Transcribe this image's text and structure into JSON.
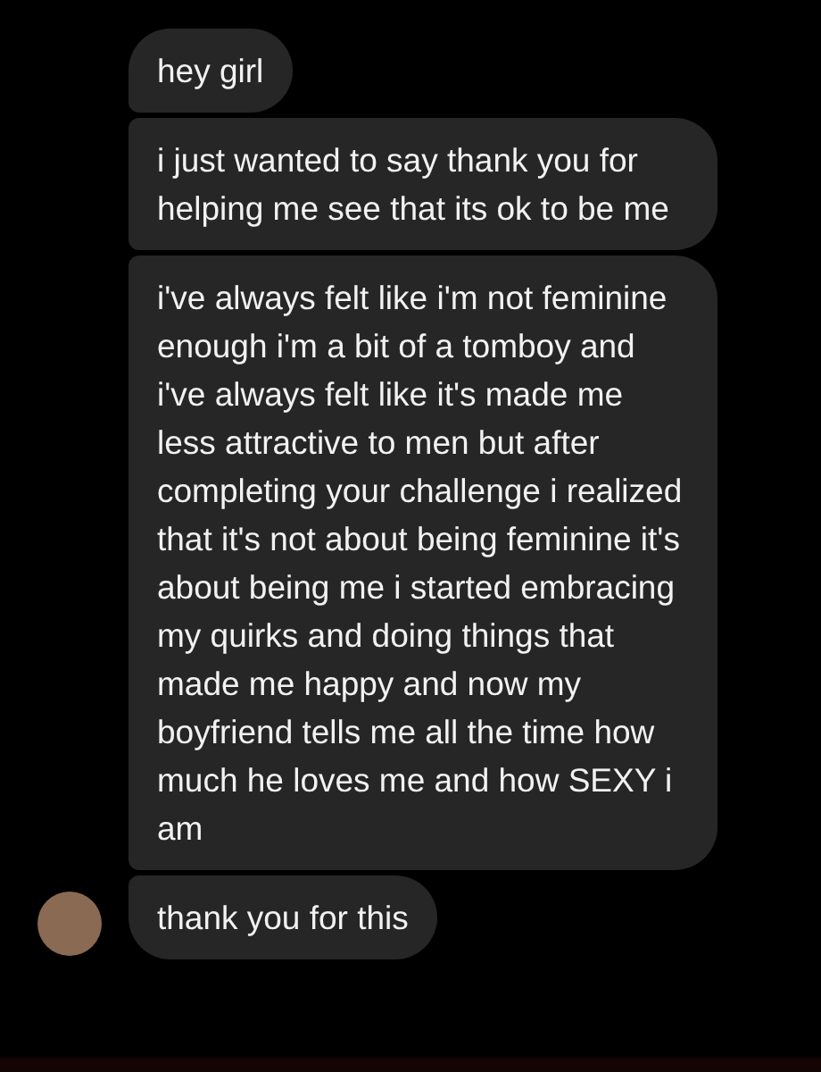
{
  "messages": [
    {
      "text": "hey girl",
      "avatar": false
    },
    {
      "text": "i just wanted to say thank you for helping me see that its ok to be me",
      "avatar": false
    },
    {
      "text": "i've always felt like i'm not feminine enough i'm a bit of a tomboy and i've always felt like it's made me less attractive to men but after completing your challenge i realized that it's not about being feminine it's about being me i started embracing my quirks and doing things that made me happy and now my boyfriend tells me all the time how much he loves me and how SEXY i am",
      "avatar": false
    },
    {
      "text": "thank you for this",
      "avatar": true
    }
  ]
}
